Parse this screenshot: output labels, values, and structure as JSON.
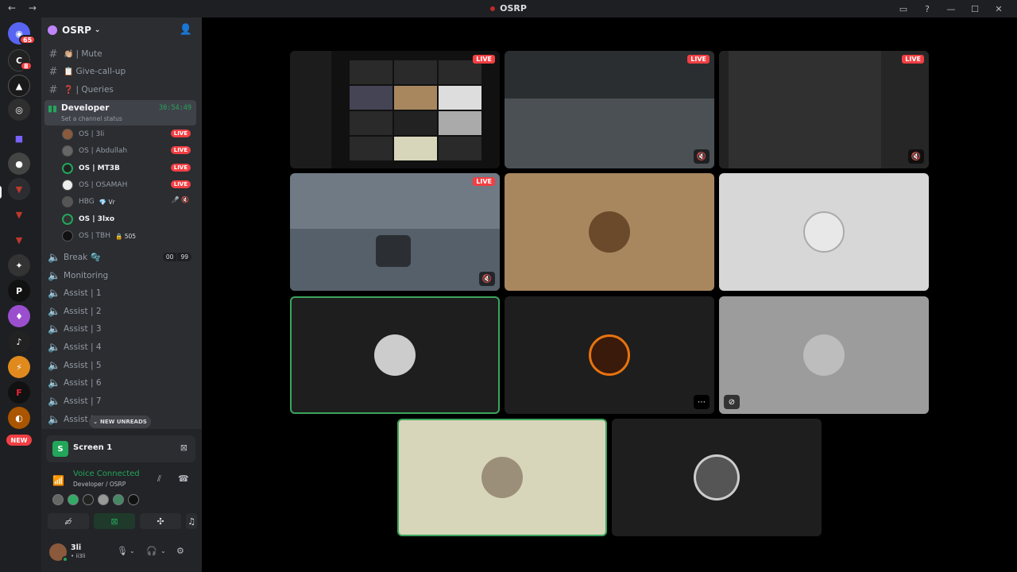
{
  "window": {
    "title": "OSRP",
    "nav": "← →",
    "controls": [
      "▭",
      "?",
      "—",
      "☐",
      "✕"
    ]
  },
  "rail": {
    "home_badge": "65",
    "second_badge": "8",
    "new_label": "NEW"
  },
  "guild": {
    "name": "OSRP"
  },
  "channels": [
    {
      "name": "| Mute",
      "emoji": "👏🏼",
      "type": "text"
    },
    {
      "name": "Give-call-up",
      "emoji": "📋",
      "type": "text"
    },
    {
      "name": "| Queries",
      "emoji": "❓",
      "type": "text"
    }
  ],
  "voice_channel": {
    "name": "Developer",
    "status": "Set a channel status",
    "timer": "30:54:49"
  },
  "members": [
    {
      "name": "OS | 3li",
      "live": "LIVE",
      "bright": false,
      "color": "#8b5a3c"
    },
    {
      "name": "OS | Abdullah",
      "live": "LIVE",
      "bright": false,
      "color": "#666"
    },
    {
      "name": "OS | MT3B",
      "live": "LIVE",
      "bright": true,
      "color": "#222"
    },
    {
      "name": "OS | OSAMAH",
      "live": "LIVE",
      "bright": false,
      "color": "#eee"
    },
    {
      "name": "HBG",
      "extra": "💎 Vr",
      "bright": false,
      "color": "#555",
      "muted": "🎤̸ 🔇"
    },
    {
      "name": "OS | 3lxo",
      "bright": true,
      "color": "#333"
    },
    {
      "name": "OS | TBH",
      "extra": "🔒 505",
      "bright": false,
      "color": "#111"
    }
  ],
  "break": {
    "name": "Break",
    "emoji": "🫧",
    "count_a": "00",
    "count_b": "99"
  },
  "voice_list": [
    "Monitoring",
    "Assist | 1",
    "Assist | 2",
    "Assist | 3",
    "Assist | 4",
    "Assist | 5",
    "Assist | 6",
    "Assist | 7",
    "Assist |"
  ],
  "new_unreads": "NEW UNREADS",
  "screen_share": {
    "label": "Screen 1"
  },
  "voice_connected": {
    "title": "Voice Connected",
    "subtitle": "Developer / OSRP"
  },
  "user": {
    "name": "3li",
    "status": "• ii3li"
  },
  "tiles": [
    {
      "kind": "stream",
      "live": "LIVE"
    },
    {
      "kind": "stream",
      "live": "LIVE",
      "muted": true
    },
    {
      "kind": "stream",
      "live": "LIVE",
      "muted": true
    },
    {
      "kind": "stream",
      "live": "LIVE",
      "muted": true
    },
    {
      "kind": "avatar",
      "bg": "#a8875f"
    },
    {
      "kind": "avatar",
      "bg": "#d7d7d7"
    },
    {
      "kind": "avatar",
      "bg": "#1e1e1e",
      "speaking": true
    },
    {
      "kind": "avatar",
      "bg": "#1e1e1e"
    },
    {
      "kind": "avatar",
      "bg": "#9c9c9c"
    },
    {
      "kind": "avatar",
      "bg": "#d8d6ba",
      "speaking": true
    },
    {
      "kind": "avatar",
      "bg": "#1e1e1e"
    }
  ]
}
